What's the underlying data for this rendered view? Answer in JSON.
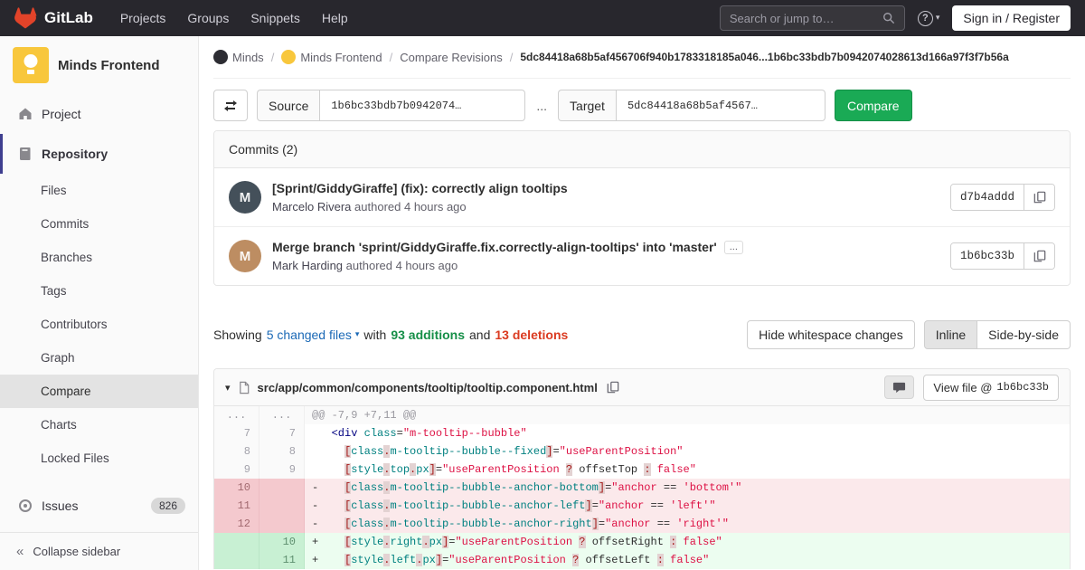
{
  "navbar": {
    "brand": "GitLab",
    "links": [
      "Projects",
      "Groups",
      "Snippets",
      "Help"
    ],
    "search_placeholder": "Search or jump to…",
    "sign_in_label": "Sign in / Register"
  },
  "sidebar": {
    "project_name": "Minds Frontend",
    "project_label": "Project",
    "repository_label": "Repository",
    "repository_items": [
      {
        "label": "Files",
        "active": false
      },
      {
        "label": "Commits",
        "active": false
      },
      {
        "label": "Branches",
        "active": false
      },
      {
        "label": "Tags",
        "active": false
      },
      {
        "label": "Contributors",
        "active": false
      },
      {
        "label": "Graph",
        "active": false
      },
      {
        "label": "Compare",
        "active": true
      },
      {
        "label": "Charts",
        "active": false
      },
      {
        "label": "Locked Files",
        "active": false
      }
    ],
    "issues_label": "Issues",
    "issues_count": "826",
    "collapse_label": "Collapse sidebar"
  },
  "breadcrumb": {
    "separator": "/",
    "items": [
      {
        "label": "Minds",
        "avatar": "dark"
      },
      {
        "label": "Minds Frontend",
        "avatar": "yellow"
      },
      {
        "label": "Compare Revisions",
        "avatar": ""
      }
    ],
    "current": "5dc84418a68b5af456706f940b1783318185a046...1b6bc33bdb7b0942074028613d166a97f3f7b56a"
  },
  "compare_form": {
    "source_label": "Source",
    "source_value": "1b6bc33bdb7b0942074…",
    "separator": "...",
    "target_label": "Target",
    "target_value": "5dc84418a68b5af4567…",
    "compare_label": "Compare"
  },
  "commits": {
    "title": "Commits (2)",
    "expander_label": "...",
    "list": [
      {
        "title": "[Sprint/GiddyGiraffe] (fix): correctly align tooltips",
        "author": "Marcelo Rivera",
        "meta": "authored 4 hours ago",
        "sha": "d7b4addd",
        "expander": false,
        "avatar_initial": "M",
        "avatar_color": "#44505a"
      },
      {
        "title": "Merge branch 'sprint/GiddyGiraffe.fix.correctly-align-tooltips' into 'master'",
        "author": "Mark Harding",
        "meta": "authored 4 hours ago",
        "sha": "1b6bc33b",
        "expander": true,
        "avatar_initial": "M",
        "avatar_color": "#bd8d62"
      }
    ]
  },
  "diff_summary": {
    "showing": "Showing",
    "changed_files": "5 changed files",
    "with_text": "with",
    "additions": "93 additions",
    "and_text": "and",
    "deletions": "13 deletions",
    "hide_whitespace": "Hide whitespace changes",
    "inline": "Inline",
    "side_by_side": "Side-by-side"
  },
  "diff_file": {
    "path": "src/app/common/components/tooltip/tooltip.component.html",
    "view_file_prefix": "View file @",
    "view_file_sha": "1b6bc33b",
    "lines": [
      {
        "type": "match",
        "old": "...",
        "new": "...",
        "tokens": [
          {
            "t": "@@ -7,9 +7,11 @@",
            "c": "hunk"
          }
        ]
      },
      {
        "type": "context",
        "old": "7",
        "new": "7",
        "tokens": [
          {
            "t": "   ",
            "c": ""
          },
          {
            "t": "<div",
            "c": "nt"
          },
          {
            "t": " ",
            "c": ""
          },
          {
            "t": "class",
            "c": "na"
          },
          {
            "t": "=",
            "c": ""
          },
          {
            "t": "\"m-tooltip--bubble\"",
            "c": "s"
          }
        ]
      },
      {
        "type": "context",
        "old": "8",
        "new": "8",
        "tokens": [
          {
            "t": "     ",
            "c": ""
          },
          {
            "t": "[",
            "c": "err"
          },
          {
            "t": "class",
            "c": "na"
          },
          {
            "t": ".",
            "c": "err"
          },
          {
            "t": "m-tooltip--bubble--fixed",
            "c": "na"
          },
          {
            "t": "]",
            "c": "err"
          },
          {
            "t": "=",
            "c": ""
          },
          {
            "t": "\"useParentPosition\"",
            "c": "s"
          }
        ]
      },
      {
        "type": "context",
        "old": "9",
        "new": "9",
        "tokens": [
          {
            "t": "     ",
            "c": ""
          },
          {
            "t": "[",
            "c": "err"
          },
          {
            "t": "style",
            "c": "na"
          },
          {
            "t": ".",
            "c": "err"
          },
          {
            "t": "top",
            "c": "na"
          },
          {
            "t": ".",
            "c": "err"
          },
          {
            "t": "px",
            "c": "na"
          },
          {
            "t": "]",
            "c": "err"
          },
          {
            "t": "=",
            "c": ""
          },
          {
            "t": "\"useParentPosition ",
            "c": "s"
          },
          {
            "t": "?",
            "c": "err"
          },
          {
            "t": " offsetTop ",
            "c": ""
          },
          {
            "t": ":",
            "c": "err"
          },
          {
            "t": " false\"",
            "c": "s"
          }
        ]
      },
      {
        "type": "del",
        "old": "10",
        "new": "",
        "tokens": [
          {
            "t": "-    ",
            "c": ""
          },
          {
            "t": "[",
            "c": "err"
          },
          {
            "t": "class",
            "c": "na"
          },
          {
            "t": ".",
            "c": "err"
          },
          {
            "t": "m-tooltip--bubble--anchor-bottom",
            "c": "na"
          },
          {
            "t": "]",
            "c": "err"
          },
          {
            "t": "=",
            "c": ""
          },
          {
            "t": "\"anchor",
            "c": "s"
          },
          {
            "t": " == ",
            "c": ""
          },
          {
            "t": "'bottom'\"",
            "c": "s"
          }
        ]
      },
      {
        "type": "del",
        "old": "11",
        "new": "",
        "tokens": [
          {
            "t": "-    ",
            "c": ""
          },
          {
            "t": "[",
            "c": "err"
          },
          {
            "t": "class",
            "c": "na"
          },
          {
            "t": ".",
            "c": "err"
          },
          {
            "t": "m-tooltip--bubble--anchor-left",
            "c": "na"
          },
          {
            "t": "]",
            "c": "err"
          },
          {
            "t": "=",
            "c": ""
          },
          {
            "t": "\"anchor",
            "c": "s"
          },
          {
            "t": " == ",
            "c": ""
          },
          {
            "t": "'left'\"",
            "c": "s"
          }
        ]
      },
      {
        "type": "del",
        "old": "12",
        "new": "",
        "tokens": [
          {
            "t": "-    ",
            "c": ""
          },
          {
            "t": "[",
            "c": "err"
          },
          {
            "t": "class",
            "c": "na"
          },
          {
            "t": ".",
            "c": "err"
          },
          {
            "t": "m-tooltip--bubble--anchor-right",
            "c": "na"
          },
          {
            "t": "]",
            "c": "err"
          },
          {
            "t": "=",
            "c": ""
          },
          {
            "t": "\"anchor",
            "c": "s"
          },
          {
            "t": " == ",
            "c": ""
          },
          {
            "t": "'right'\"",
            "c": "s"
          }
        ]
      },
      {
        "type": "add",
        "old": "",
        "new": "10",
        "tokens": [
          {
            "t": "+    ",
            "c": ""
          },
          {
            "t": "[",
            "c": "err"
          },
          {
            "t": "style",
            "c": "na"
          },
          {
            "t": ".",
            "c": "err"
          },
          {
            "t": "right",
            "c": "na"
          },
          {
            "t": ".",
            "c": "err"
          },
          {
            "t": "px",
            "c": "na"
          },
          {
            "t": "]",
            "c": "err"
          },
          {
            "t": "=",
            "c": ""
          },
          {
            "t": "\"useParentPosition ",
            "c": "s"
          },
          {
            "t": "?",
            "c": "err"
          },
          {
            "t": " offsetRight ",
            "c": ""
          },
          {
            "t": ":",
            "c": "err"
          },
          {
            "t": " false\"",
            "c": "s"
          }
        ]
      },
      {
        "type": "add",
        "old": "",
        "new": "11",
        "tokens": [
          {
            "t": "+    ",
            "c": ""
          },
          {
            "t": "[",
            "c": "err"
          },
          {
            "t": "style",
            "c": "na"
          },
          {
            "t": ".",
            "c": "err"
          },
          {
            "t": "left",
            "c": "na"
          },
          {
            "t": ".",
            "c": "err"
          },
          {
            "t": "px",
            "c": "na"
          },
          {
            "t": "]",
            "c": "err"
          },
          {
            "t": "=",
            "c": ""
          },
          {
            "t": "\"useParentPosition ",
            "c": "s"
          },
          {
            "t": "?",
            "c": "err"
          },
          {
            "t": " offsetLeft ",
            "c": ""
          },
          {
            "t": ":",
            "c": "err"
          },
          {
            "t": " false\"",
            "c": "s"
          }
        ]
      }
    ]
  },
  "colors": {
    "navbar_bg": "#28272d",
    "compare_button_green": "#1aaa55",
    "addition_green": "#168f48",
    "deletion_red": "#db3b21",
    "link_blue": "#1b69b6",
    "project_avatar_yellow": "#f8c73c",
    "removed_line_bg": "#fbe9eb",
    "added_line_bg": "#ecfdf0"
  }
}
